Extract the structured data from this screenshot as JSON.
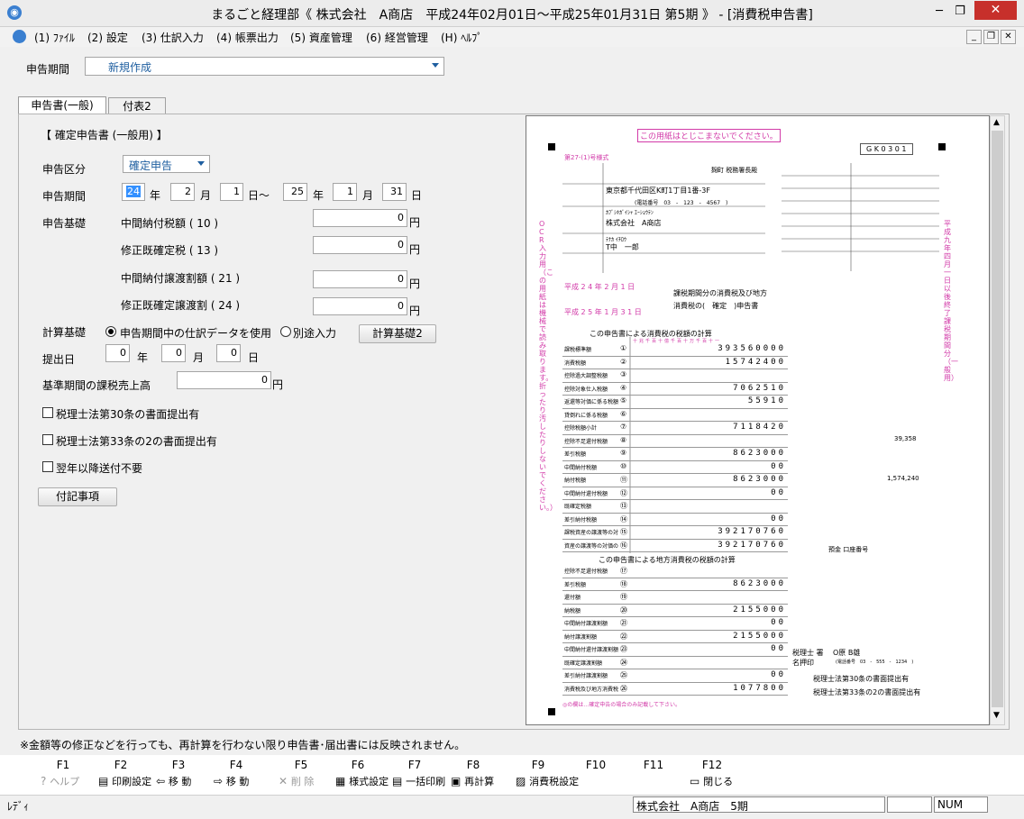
{
  "window": {
    "title": "まるごと経理部《 株式会社　A商店　平成24年02月01日～平成25年01月31日 第5期 》 - [消費税申告書]",
    "minimize": "─",
    "restore": "❐",
    "close": "✕"
  },
  "menu": [
    "(1) ﾌｧｲﾙ",
    "(2) 設定",
    "(3) 仕訳入力",
    "(4) 帳票出力",
    "(5) 資産管理",
    "(6) 経営管理",
    "(H) ﾍﾙﾌﾟ"
  ],
  "period_select": {
    "label": "申告期間",
    "value": "新規作成"
  },
  "tabs": [
    "申告書(一般)",
    "付表2"
  ],
  "section_title": "【 確定申告書 (一般用) 】",
  "form": {
    "kubun": {
      "label": "申告区分",
      "value": "確定申告"
    },
    "period": {
      "label": "申告期間",
      "y1": "24",
      "m1": "2",
      "d1": "1",
      "y2": "25",
      "m2": "1",
      "d2": "31",
      "nen": "年",
      "tsuki": "月",
      "hi": "日",
      "kara": "日～"
    },
    "kiso": {
      "label": "申告基礎"
    },
    "fields": [
      {
        "label": "中間納付税額 ( 10 )",
        "value": "0",
        "unit": "円"
      },
      {
        "label": "修正既確定税 ( 13 )",
        "value": "0",
        "unit": "円"
      },
      {
        "label": "中間納付譲渡割額 ( 21 )",
        "value": "0",
        "unit": "円"
      },
      {
        "label": "修正既確定譲渡割 ( 24 )",
        "value": "0",
        "unit": "円"
      }
    ],
    "calc": {
      "label": "計算基礎",
      "opt1": "申告期間中の仕訳データを使用",
      "opt2": "別途入力",
      "button": "計算基礎2"
    },
    "teishutsu": {
      "label": "提出日",
      "y": "0",
      "m": "0",
      "d": "0"
    },
    "kijun": {
      "label": "基準期間の課税売上高",
      "value": "0",
      "unit": "円"
    },
    "checks": [
      "税理士法第30条の書面提出有",
      "税理士法第33条の2の書面提出有",
      "翌年以降送付不要"
    ],
    "fuki_button": "付記事項"
  },
  "notice": "※金額等の修正などを行っても、再計算を行わない限り申告書･届出書には反映されません。",
  "fkeys": [
    {
      "key": "F1",
      "label": "ヘルプ",
      "icon": "help-icon"
    },
    {
      "key": "F2",
      "label": "印刷設定",
      "icon": "printer-icon"
    },
    {
      "key": "F3",
      "label": "移 動",
      "icon": "arrow-left-icon"
    },
    {
      "key": "F4",
      "label": "移 動",
      "icon": "arrow-right-icon"
    },
    {
      "key": "F5",
      "label": "削 除",
      "icon": "delete-icon"
    },
    {
      "key": "F6",
      "label": "様式設定",
      "icon": "form-icon"
    },
    {
      "key": "F7",
      "label": "一括印刷",
      "icon": "printer-icon"
    },
    {
      "key": "F8",
      "label": "再計算",
      "icon": "calculator-icon"
    },
    {
      "key": "F9",
      "label": "消費税設定",
      "icon": "settings-icon"
    },
    {
      "key": "F10",
      "label": "",
      "icon": ""
    },
    {
      "key": "F11",
      "label": "",
      "icon": ""
    },
    {
      "key": "F12",
      "label": "閉じる",
      "icon": "folder-close-icon"
    }
  ],
  "status": {
    "mode": "ﾚﾃﾞｨ",
    "company": "株式会社　A商店　5期",
    "num": "NUM"
  },
  "tax_form": {
    "top_note": "この用紙はとじこまないでください。",
    "code": "G K 0 3 0 1",
    "form_no": "第27-(1)号様式",
    "office": "麹町 税務署長殿",
    "address": "東京都千代田区K町1丁目1番-3F",
    "tel": "(電話番号　03　-　123　-　4567　)",
    "furigana_name": "ｶﾌﾞｼｷｶﾞｲｼｬ ｴｰｼｮｳﾃﾝ",
    "company_name": "株式会社　A商店",
    "furigana_rep": "ﾃﾅｶ ｲﾁﾛｳ",
    "rep_name": "T中　一郎",
    "period_from": "平成 2 4 年 2 月 1 日",
    "period_to": "平成 2 5 年 1 月 3 1 日",
    "kazei_title": "課税期間分の消費税及び地方",
    "kazei_title2": "消費税の(　確定　)申告書",
    "calc_title": "この申告書による消費税の税額の計算",
    "local_title": "この申告書による地方消費税の税額の計算",
    "digits": "十兆千百十億千百十万千百十一",
    "rows": [
      {
        "n": "①",
        "label": "課税標準額",
        "v": "393560000"
      },
      {
        "n": "②",
        "label": "消費税額",
        "v": "15742400"
      },
      {
        "n": "③",
        "label": "控除過大調整税額",
        "v": ""
      },
      {
        "n": "④",
        "label": "控除対象仕入税額",
        "v": "7062510"
      },
      {
        "n": "⑤",
        "label": "返還等対価に係る税額",
        "v": "55910"
      },
      {
        "n": "⑥",
        "label": "貸倒れに係る税額",
        "v": ""
      },
      {
        "n": "⑦",
        "label": "控除税額小計",
        "v": "7118420"
      },
      {
        "n": "⑧",
        "label": "控除不足還付税額",
        "v": ""
      },
      {
        "n": "⑨",
        "label": "差引税額",
        "v": "8623000"
      },
      {
        "n": "⑩",
        "label": "中間納付税額",
        "v": "00"
      },
      {
        "n": "⑪",
        "label": "納付税額",
        "v": "8623000"
      },
      {
        "n": "⑫",
        "label": "中間納付還付税額",
        "v": "00"
      },
      {
        "n": "⑬",
        "label": "既確定税額",
        "v": ""
      },
      {
        "n": "⑭",
        "label": "差引納付税額",
        "v": "00"
      },
      {
        "n": "⑮",
        "label": "課税資産の譲渡等の対価の額",
        "v": "392170760"
      },
      {
        "n": "⑯",
        "label": "資産の譲渡等の対価の額",
        "v": "392170760"
      }
    ],
    "local_rows": [
      {
        "n": "⑰",
        "label": "控除不足還付税額",
        "v": ""
      },
      {
        "n": "⑱",
        "label": "差引税額",
        "v": "8623000"
      },
      {
        "n": "⑲",
        "label": "還付額",
        "v": ""
      },
      {
        "n": "⑳",
        "label": "納税額",
        "v": "2155000"
      },
      {
        "n": "㉑",
        "label": "中間納付譲渡割額",
        "v": "00"
      },
      {
        "n": "㉒",
        "label": "納付譲渡割額",
        "v": "2155000"
      },
      {
        "n": "㉓",
        "label": "中間納付還付譲渡割額",
        "v": "00"
      },
      {
        "n": "㉔",
        "label": "既確定譲渡割額",
        "v": ""
      },
      {
        "n": "㉕",
        "label": "差引納付譲渡割額",
        "v": "00"
      },
      {
        "n": "㉖",
        "label": "消費税及び地方消費税の合計税額",
        "v": "1077800"
      }
    ],
    "right_amounts": {
      "a": "39,358",
      "b": "1,574,240"
    },
    "bank_label": "預金 口座番号",
    "zeirishi": "税理士 署名押印",
    "zeirishi_name": "O原 B雄",
    "zeirishi_tel": "(電話番号　03　-　555　-　1234　)",
    "check30": "税理士法第30条の書面提出有",
    "check33": "税理士法第33条の2の書面提出有",
    "left_vertical": "OCR入力用（この用紙は機械で読み取ります。折ったり汚したりしないでください。）",
    "right_vertical": "平成九年四月一日以後終了課税期間分（一般用）",
    "bottom_note": "◎の欄は…確定申告の場合のみ記載して下さい。"
  }
}
